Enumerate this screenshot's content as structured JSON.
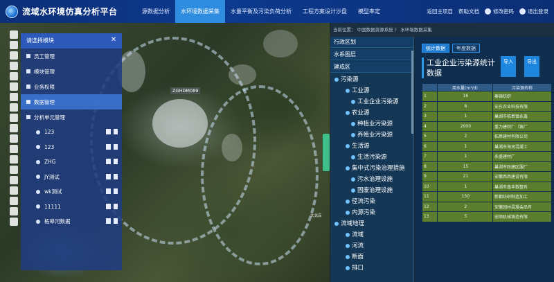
{
  "header": {
    "title": "流域水环境仿真分析平台",
    "nav": [
      "源数据分析",
      "水环境数据采集",
      "水量平衡及污染负荷分析",
      "工程方案设计沙盘",
      "模型率定"
    ],
    "active_nav_index": 1,
    "right": {
      "back": "返回主项目",
      "help": "帮助文档",
      "change_password": "修改密码",
      "logout": "退出登录"
    }
  },
  "map": {
    "label": "ZGHDM089",
    "towns": [
      "大关店"
    ]
  },
  "module_panel": {
    "title": "请选择模块",
    "items": [
      "员工管理",
      "模块管理",
      "业务权限",
      "数据管理",
      "分析单元管理"
    ],
    "active_index": 3,
    "sub_items": [
      "123",
      "123",
      "ZHG",
      "JY测试",
      "wk测试",
      "11111",
      "柘皋河数据"
    ]
  },
  "breadcrumb": "当前位置： 中国数据资源系统  〉 水环境数据采集",
  "tree": {
    "tabs": [
      "行政区划",
      "水系图层",
      "建成区"
    ],
    "nodes": [
      {
        "label": "污染源",
        "level": 0
      },
      {
        "label": "工业源",
        "level": 1
      },
      {
        "label": "工业企业污染源",
        "level": 2
      },
      {
        "label": "农业源",
        "level": 1
      },
      {
        "label": "种植业污染源",
        "level": 2
      },
      {
        "label": "养殖业污染源",
        "level": 2
      },
      {
        "label": "生活源",
        "level": 1
      },
      {
        "label": "生活污染源",
        "level": 2
      },
      {
        "label": "集中式污染治理措施",
        "level": 1
      },
      {
        "label": "污水治理设施",
        "level": 2
      },
      {
        "label": "固废治理设施",
        "level": 2
      },
      {
        "label": "径流污染",
        "level": 1
      },
      {
        "label": "内源污染",
        "level": 1
      },
      {
        "label": "流域地理",
        "level": 0
      },
      {
        "label": "流域",
        "level": 1
      },
      {
        "label": "河流",
        "level": 1
      },
      {
        "label": "断面",
        "level": 1
      },
      {
        "label": "排口",
        "level": 1
      }
    ]
  },
  "stats": {
    "tabs": [
      "统计数据",
      "年度数据"
    ],
    "title": "工业企业污染源统计数据",
    "import_label": "导入",
    "export_label": "导出",
    "columns": [
      "",
      "用水量(m³/d)",
      "污染源名称"
    ],
    "rows": [
      [
        "1",
        "16",
        "秦锦纺织"
      ],
      [
        "2",
        "8",
        "安东农业科技有限"
      ],
      [
        "3",
        "1",
        "巢湖市柘皋镇永鑫"
      ],
      [
        "4",
        "2000",
        "重力建材厂（铸厂"
      ],
      [
        "5",
        "2",
        "柘皋建材有限公司"
      ],
      [
        "6",
        "1",
        "巢湖市海润混凝土"
      ],
      [
        "7",
        "1",
        "永盛建材厂"
      ],
      [
        "8",
        "15",
        "巢湖市跃建区服厂"
      ],
      [
        "9",
        "21",
        "安徽西西建设有限"
      ],
      [
        "10",
        "1",
        "巢湖市鑫丰数整有"
      ],
      [
        "11",
        "150",
        "新都纺织制造加工"
      ],
      [
        "12",
        "2",
        "安徽园林混凝会品有"
      ],
      [
        "13",
        "5",
        "宏顺机械铸造有限"
      ]
    ]
  }
}
